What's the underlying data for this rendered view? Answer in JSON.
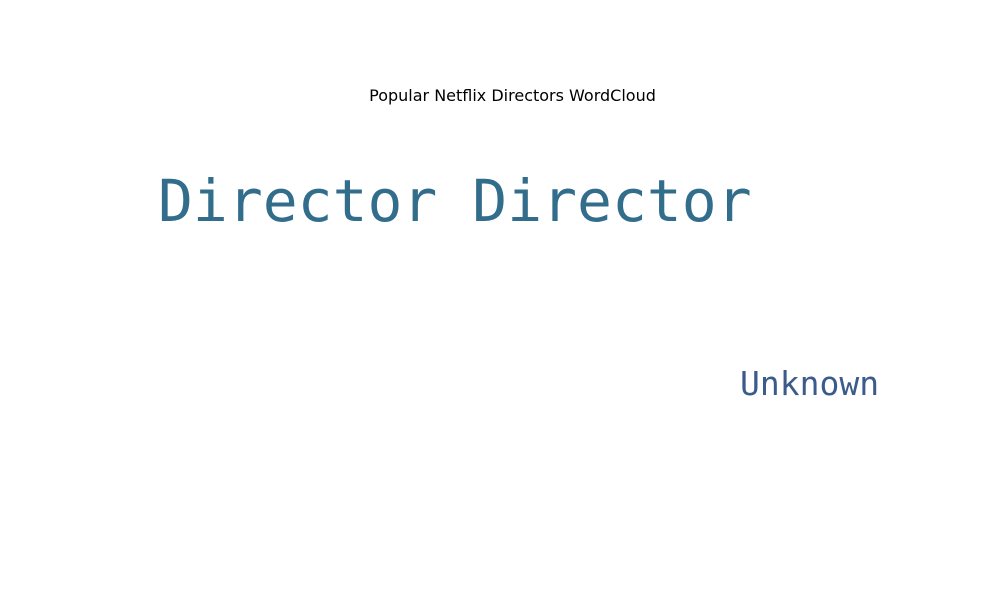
{
  "chart_data": {
    "type": "wordcloud",
    "title": "Popular Netflix Directors WordCloud",
    "words": [
      {
        "text": "Director Director",
        "weight": 1.0,
        "color": "#336d8c"
      },
      {
        "text": "Unknown",
        "weight": 0.57,
        "color": "#3b5c8a"
      }
    ],
    "background": "#ffffff"
  }
}
